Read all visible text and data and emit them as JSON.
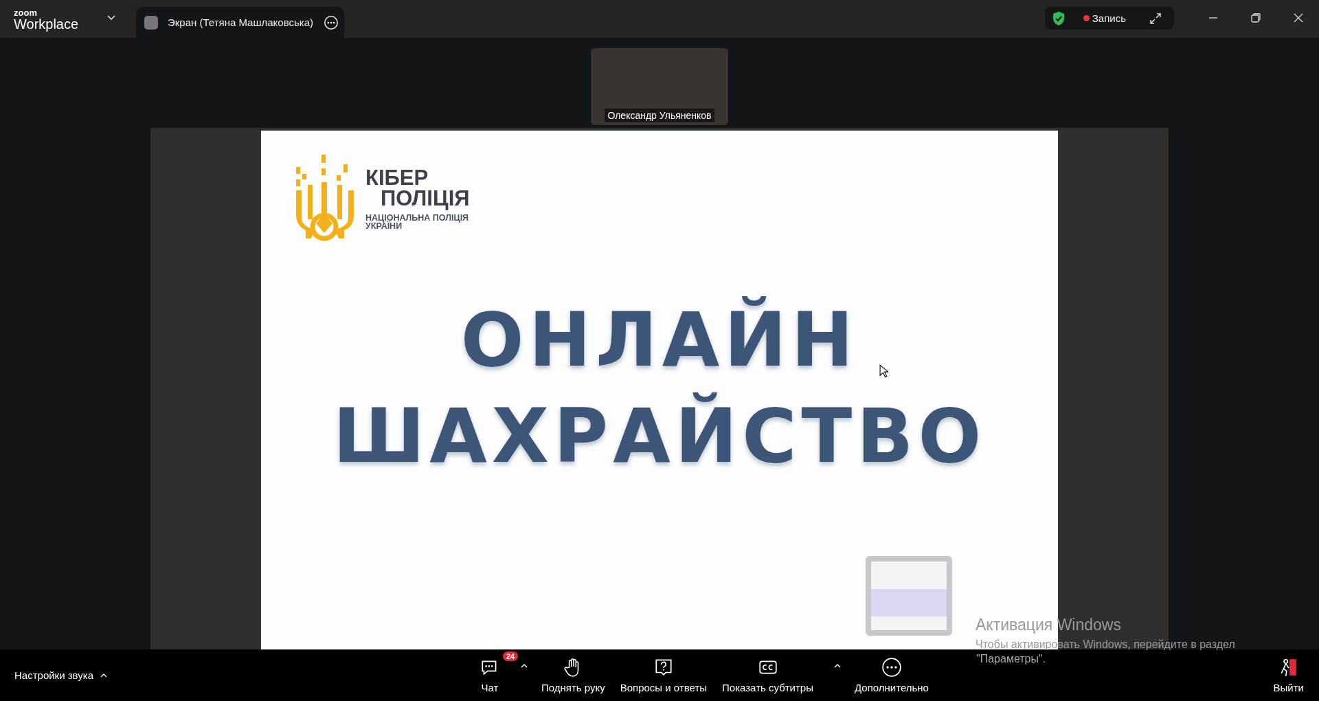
{
  "app": {
    "brand_small": "zoom",
    "brand": "Workplace"
  },
  "share_tab": {
    "title": "Экран (Тетяна Машлаковська)"
  },
  "recording": {
    "label": "Запись",
    "on": true
  },
  "video": {
    "name": "Олександр Ульяненков"
  },
  "slide": {
    "logo_title": [
      "КІБЕР",
      "ПОЛІЦІЯ"
    ],
    "logo_subtitle": [
      "НАЦІОНАЛЬНА ПОЛІЦІЯ",
      "УКРАЇНИ"
    ],
    "headline": [
      "ОНЛАЙН",
      "ШАХРАЙСТВО"
    ]
  },
  "os_notice": {
    "title": "Активация Windows",
    "text": "Чтобы активировать Windows, перейдите в раздел",
    "text2": "\"Параметры\"."
  },
  "toolbar": {
    "audio": "Настройки звука",
    "items": [
      {
        "kind": "chat",
        "label": "Чат",
        "badge": "24",
        "caret": true
      },
      {
        "kind": "hand",
        "label": "Поднять руку",
        "caret": false
      },
      {
        "kind": "qa",
        "label": "Вопросы и ответы",
        "caret": false
      },
      {
        "kind": "cc",
        "label": "Показать субтитры",
        "caret": true
      },
      {
        "kind": "more",
        "label": "Дополнительно",
        "caret": false
      }
    ],
    "leave": "Выйти"
  }
}
